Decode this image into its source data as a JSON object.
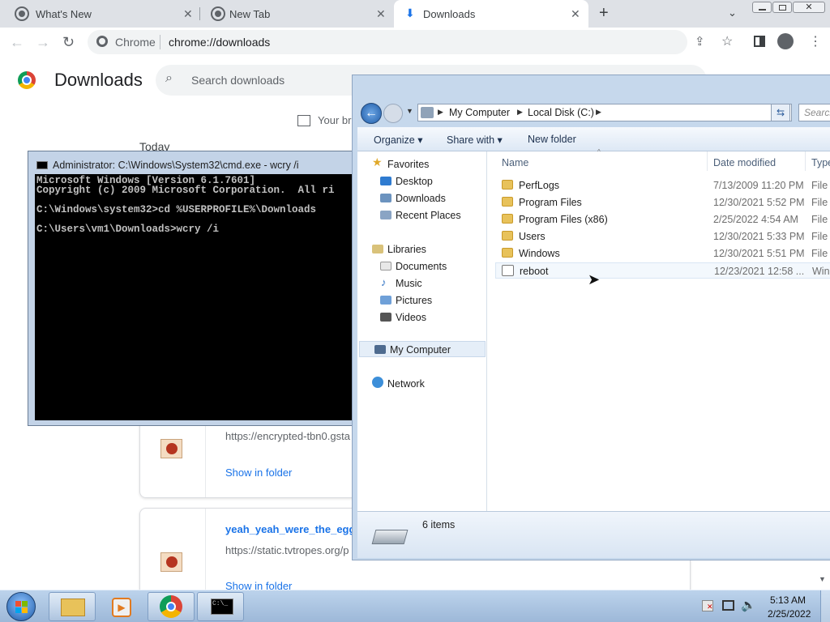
{
  "browser": {
    "tabs": [
      {
        "title": "What's New"
      },
      {
        "title": "New Tab"
      },
      {
        "title": "Downloads"
      }
    ],
    "new_tab_icon": "plus-icon",
    "omnibox": {
      "site_label": "Chrome",
      "url": "chrome://downloads"
    }
  },
  "downloads_page": {
    "title": "Downloads",
    "search_placeholder": "Search downloads",
    "notice_partial": "Your br",
    "today_label": "Today",
    "items": [
      {
        "url": "https://encrypted-tbn0.gsta",
        "action": "Show in folder"
      },
      {
        "name": "yeah_yeah_were_the_eggs_",
        "url": "https://static.tvtropes.org/p",
        "action": "Show in folder"
      }
    ]
  },
  "cmd": {
    "title": "Administrator: C:\\Windows\\System32\\cmd.exe - wcry  /i",
    "lines": [
      "Microsoft Windows [Version 6.1.7601]",
      "Copyright (c) 2009 Microsoft Corporation.  All ri",
      "",
      "C:\\Windows\\system32>cd %USERPROFILE%\\Downloads",
      "",
      "C:\\Users\\vm1\\Downloads>wcry /i"
    ]
  },
  "explorer": {
    "breadcrumb": [
      "My Computer",
      "Local Disk (C:)"
    ],
    "search_placeholder": "Search",
    "commands": {
      "organize": "Organize",
      "share": "Share with",
      "new_folder": "New folder"
    },
    "nav": {
      "favorites": "Favorites",
      "desktop": "Desktop",
      "downloads": "Downloads",
      "recent": "Recent Places",
      "libraries": "Libraries",
      "documents": "Documents",
      "music": "Music",
      "pictures": "Pictures",
      "videos": "Videos",
      "computer": "My Computer",
      "network": "Network"
    },
    "columns": {
      "name": "Name",
      "date": "Date modified",
      "type": "Type"
    },
    "rows": [
      {
        "name": "PerfLogs",
        "date": "7/13/2009 11:20 PM",
        "type": "File f"
      },
      {
        "name": "Program Files",
        "date": "12/30/2021 5:52 PM",
        "type": "File f"
      },
      {
        "name": "Program Files (x86)",
        "date": "2/25/2022 4:54 AM",
        "type": "File f"
      },
      {
        "name": "Users",
        "date": "12/30/2021 5:33 PM",
        "type": "File f"
      },
      {
        "name": "Windows",
        "date": "12/30/2021 5:51 PM",
        "type": "File f"
      },
      {
        "name": "reboot",
        "date": "12/23/2021 12:58 ...",
        "type": "Wind"
      }
    ],
    "status": "6 items"
  },
  "taskbar": {
    "time": "5:13 AM",
    "date": "2/25/2022"
  }
}
